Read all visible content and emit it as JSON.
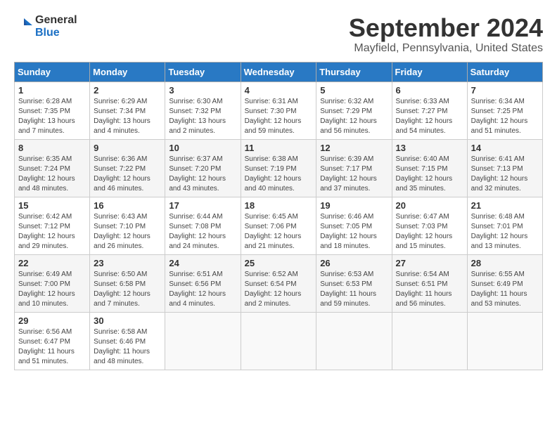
{
  "header": {
    "logo_general": "General",
    "logo_blue": "Blue",
    "month_year": "September 2024",
    "location": "Mayfield, Pennsylvania, United States"
  },
  "columns": [
    "Sunday",
    "Monday",
    "Tuesday",
    "Wednesday",
    "Thursday",
    "Friday",
    "Saturday"
  ],
  "weeks": [
    [
      {
        "day": "1",
        "sunrise": "Sunrise: 6:28 AM",
        "sunset": "Sunset: 7:35 PM",
        "daylight": "Daylight: 13 hours and 7 minutes."
      },
      {
        "day": "2",
        "sunrise": "Sunrise: 6:29 AM",
        "sunset": "Sunset: 7:34 PM",
        "daylight": "Daylight: 13 hours and 4 minutes."
      },
      {
        "day": "3",
        "sunrise": "Sunrise: 6:30 AM",
        "sunset": "Sunset: 7:32 PM",
        "daylight": "Daylight: 13 hours and 2 minutes."
      },
      {
        "day": "4",
        "sunrise": "Sunrise: 6:31 AM",
        "sunset": "Sunset: 7:30 PM",
        "daylight": "Daylight: 12 hours and 59 minutes."
      },
      {
        "day": "5",
        "sunrise": "Sunrise: 6:32 AM",
        "sunset": "Sunset: 7:29 PM",
        "daylight": "Daylight: 12 hours and 56 minutes."
      },
      {
        "day": "6",
        "sunrise": "Sunrise: 6:33 AM",
        "sunset": "Sunset: 7:27 PM",
        "daylight": "Daylight: 12 hours and 54 minutes."
      },
      {
        "day": "7",
        "sunrise": "Sunrise: 6:34 AM",
        "sunset": "Sunset: 7:25 PM",
        "daylight": "Daylight: 12 hours and 51 minutes."
      }
    ],
    [
      {
        "day": "8",
        "sunrise": "Sunrise: 6:35 AM",
        "sunset": "Sunset: 7:24 PM",
        "daylight": "Daylight: 12 hours and 48 minutes."
      },
      {
        "day": "9",
        "sunrise": "Sunrise: 6:36 AM",
        "sunset": "Sunset: 7:22 PM",
        "daylight": "Daylight: 12 hours and 46 minutes."
      },
      {
        "day": "10",
        "sunrise": "Sunrise: 6:37 AM",
        "sunset": "Sunset: 7:20 PM",
        "daylight": "Daylight: 12 hours and 43 minutes."
      },
      {
        "day": "11",
        "sunrise": "Sunrise: 6:38 AM",
        "sunset": "Sunset: 7:19 PM",
        "daylight": "Daylight: 12 hours and 40 minutes."
      },
      {
        "day": "12",
        "sunrise": "Sunrise: 6:39 AM",
        "sunset": "Sunset: 7:17 PM",
        "daylight": "Daylight: 12 hours and 37 minutes."
      },
      {
        "day": "13",
        "sunrise": "Sunrise: 6:40 AM",
        "sunset": "Sunset: 7:15 PM",
        "daylight": "Daylight: 12 hours and 35 minutes."
      },
      {
        "day": "14",
        "sunrise": "Sunrise: 6:41 AM",
        "sunset": "Sunset: 7:13 PM",
        "daylight": "Daylight: 12 hours and 32 minutes."
      }
    ],
    [
      {
        "day": "15",
        "sunrise": "Sunrise: 6:42 AM",
        "sunset": "Sunset: 7:12 PM",
        "daylight": "Daylight: 12 hours and 29 minutes."
      },
      {
        "day": "16",
        "sunrise": "Sunrise: 6:43 AM",
        "sunset": "Sunset: 7:10 PM",
        "daylight": "Daylight: 12 hours and 26 minutes."
      },
      {
        "day": "17",
        "sunrise": "Sunrise: 6:44 AM",
        "sunset": "Sunset: 7:08 PM",
        "daylight": "Daylight: 12 hours and 24 minutes."
      },
      {
        "day": "18",
        "sunrise": "Sunrise: 6:45 AM",
        "sunset": "Sunset: 7:06 PM",
        "daylight": "Daylight: 12 hours and 21 minutes."
      },
      {
        "day": "19",
        "sunrise": "Sunrise: 6:46 AM",
        "sunset": "Sunset: 7:05 PM",
        "daylight": "Daylight: 12 hours and 18 minutes."
      },
      {
        "day": "20",
        "sunrise": "Sunrise: 6:47 AM",
        "sunset": "Sunset: 7:03 PM",
        "daylight": "Daylight: 12 hours and 15 minutes."
      },
      {
        "day": "21",
        "sunrise": "Sunrise: 6:48 AM",
        "sunset": "Sunset: 7:01 PM",
        "daylight": "Daylight: 12 hours and 13 minutes."
      }
    ],
    [
      {
        "day": "22",
        "sunrise": "Sunrise: 6:49 AM",
        "sunset": "Sunset: 7:00 PM",
        "daylight": "Daylight: 12 hours and 10 minutes."
      },
      {
        "day": "23",
        "sunrise": "Sunrise: 6:50 AM",
        "sunset": "Sunset: 6:58 PM",
        "daylight": "Daylight: 12 hours and 7 minutes."
      },
      {
        "day": "24",
        "sunrise": "Sunrise: 6:51 AM",
        "sunset": "Sunset: 6:56 PM",
        "daylight": "Daylight: 12 hours and 4 minutes."
      },
      {
        "day": "25",
        "sunrise": "Sunrise: 6:52 AM",
        "sunset": "Sunset: 6:54 PM",
        "daylight": "Daylight: 12 hours and 2 minutes."
      },
      {
        "day": "26",
        "sunrise": "Sunrise: 6:53 AM",
        "sunset": "Sunset: 6:53 PM",
        "daylight": "Daylight: 11 hours and 59 minutes."
      },
      {
        "day": "27",
        "sunrise": "Sunrise: 6:54 AM",
        "sunset": "Sunset: 6:51 PM",
        "daylight": "Daylight: 11 hours and 56 minutes."
      },
      {
        "day": "28",
        "sunrise": "Sunrise: 6:55 AM",
        "sunset": "Sunset: 6:49 PM",
        "daylight": "Daylight: 11 hours and 53 minutes."
      }
    ],
    [
      {
        "day": "29",
        "sunrise": "Sunrise: 6:56 AM",
        "sunset": "Sunset: 6:47 PM",
        "daylight": "Daylight: 11 hours and 51 minutes."
      },
      {
        "day": "30",
        "sunrise": "Sunrise: 6:58 AM",
        "sunset": "Sunset: 6:46 PM",
        "daylight": "Daylight: 11 hours and 48 minutes."
      },
      null,
      null,
      null,
      null,
      null
    ]
  ]
}
